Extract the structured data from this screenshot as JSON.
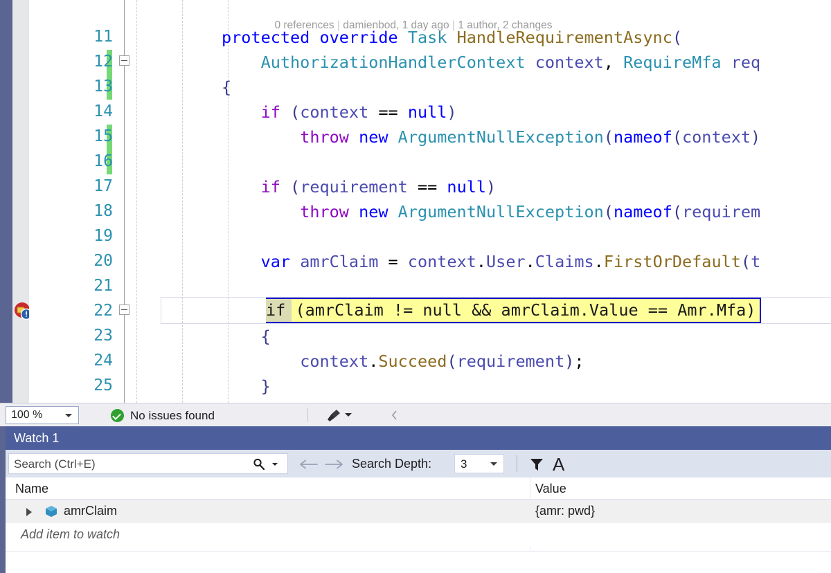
{
  "editor": {
    "codelens": {
      "references": "0 references",
      "author_change": "damienbod, 1 day ago",
      "changes": "1 author, 2 changes",
      "separator": "|"
    },
    "zoom_level": "100 %",
    "lines": [
      {
        "number": "11",
        "indent": 0,
        "tokens": [
          {
            "t": "protected ",
            "c": "kw"
          },
          {
            "t": "override ",
            "c": "kw"
          },
          {
            "t": "Task ",
            "c": "typ"
          },
          {
            "t": "HandleRequirementAsync",
            "c": "mth"
          },
          {
            "t": "(",
            "c": "brc"
          }
        ]
      },
      {
        "number": "12",
        "indent": 0,
        "tokens": [
          {
            "t": "    ",
            "c": "pun"
          },
          {
            "t": "AuthorizationHandlerContext ",
            "c": "typ"
          },
          {
            "t": "context",
            "c": "par"
          },
          {
            "t": ", ",
            "c": "pun"
          },
          {
            "t": "RequireMfa ",
            "c": "typ"
          },
          {
            "t": "req",
            "c": "par"
          }
        ]
      },
      {
        "number": "13",
        "indent": 0,
        "tokens": [
          {
            "t": "{",
            "c": "brc"
          }
        ]
      },
      {
        "number": "14",
        "indent": 0,
        "tokens": [
          {
            "t": "    ",
            "c": "pun"
          },
          {
            "t": "if",
            "c": "ctl"
          },
          {
            "t": " (",
            "c": "brc"
          },
          {
            "t": "context",
            "c": "par"
          },
          {
            "t": " == ",
            "c": "pun"
          },
          {
            "t": "null",
            "c": "kw"
          },
          {
            "t": ")",
            "c": "brc"
          }
        ]
      },
      {
        "number": "15",
        "indent": 0,
        "tokens": [
          {
            "t": "        ",
            "c": "pun"
          },
          {
            "t": "throw ",
            "c": "ctl"
          },
          {
            "t": "new ",
            "c": "kw"
          },
          {
            "t": "ArgumentNullException",
            "c": "typ"
          },
          {
            "t": "(",
            "c": "brc"
          },
          {
            "t": "nameof",
            "c": "kw"
          },
          {
            "t": "(",
            "c": "brc"
          },
          {
            "t": "context",
            "c": "par"
          },
          {
            "t": ")",
            "c": "brc"
          }
        ]
      },
      {
        "number": "16",
        "indent": 0,
        "tokens": []
      },
      {
        "number": "17",
        "indent": 0,
        "tokens": [
          {
            "t": "    ",
            "c": "pun"
          },
          {
            "t": "if",
            "c": "ctl"
          },
          {
            "t": " (",
            "c": "brc"
          },
          {
            "t": "requirement",
            "c": "par"
          },
          {
            "t": " == ",
            "c": "pun"
          },
          {
            "t": "null",
            "c": "kw"
          },
          {
            "t": ")",
            "c": "brc"
          }
        ]
      },
      {
        "number": "18",
        "indent": 0,
        "tokens": [
          {
            "t": "        ",
            "c": "pun"
          },
          {
            "t": "throw ",
            "c": "ctl"
          },
          {
            "t": "new ",
            "c": "kw"
          },
          {
            "t": "ArgumentNullException",
            "c": "typ"
          },
          {
            "t": "(",
            "c": "brc"
          },
          {
            "t": "nameof",
            "c": "kw"
          },
          {
            "t": "(",
            "c": "brc"
          },
          {
            "t": "requirem",
            "c": "par"
          }
        ]
      },
      {
        "number": "19",
        "indent": 0,
        "tokens": []
      },
      {
        "number": "20",
        "indent": 0,
        "tokens": [
          {
            "t": "    ",
            "c": "pun"
          },
          {
            "t": "var ",
            "c": "kw"
          },
          {
            "t": "amrClaim",
            "c": "par"
          },
          {
            "t": " = ",
            "c": "pun"
          },
          {
            "t": "context",
            "c": "par"
          },
          {
            "t": ".",
            "c": "pun"
          },
          {
            "t": "User",
            "c": "par"
          },
          {
            "t": ".",
            "c": "pun"
          },
          {
            "t": "Claims",
            "c": "par"
          },
          {
            "t": ".",
            "c": "pun"
          },
          {
            "t": "FirstOrDefault",
            "c": "mth"
          },
          {
            "t": "(",
            "c": "brc"
          },
          {
            "t": "t",
            "c": "par"
          }
        ]
      },
      {
        "number": "21",
        "indent": 0,
        "tokens": []
      },
      {
        "number": "22",
        "indent": 0,
        "highlighted": true,
        "text": "if (amrClaim != null && amrClaim.Value == Amr.Mfa)",
        "tokens": []
      },
      {
        "number": "23",
        "indent": 0,
        "tokens": [
          {
            "t": "    ",
            "c": "pun"
          },
          {
            "t": "{",
            "c": "brc"
          }
        ]
      },
      {
        "number": "24",
        "indent": 0,
        "tokens": [
          {
            "t": "        ",
            "c": "pun"
          },
          {
            "t": "context",
            "c": "par"
          },
          {
            "t": ".",
            "c": "pun"
          },
          {
            "t": "Succeed",
            "c": "mth"
          },
          {
            "t": "(",
            "c": "brc"
          },
          {
            "t": "requirement",
            "c": "par"
          },
          {
            "t": ")",
            "c": "brc"
          },
          {
            "t": ";",
            "c": "pun"
          }
        ]
      },
      {
        "number": "25",
        "indent": 0,
        "tokens": [
          {
            "t": "    ",
            "c": "pun"
          },
          {
            "t": "}",
            "c": "brc"
          }
        ]
      }
    ]
  },
  "statusbar": {
    "zoom_value": "100 %",
    "issues_text": "No issues found",
    "ok_icon": "check-circle-icon",
    "brush_icon": "brush-icon",
    "chevron_icon": "chevron-left-icon"
  },
  "watch": {
    "title": "Watch 1",
    "search_placeholder": "Search (Ctrl+E)",
    "search_icon": "magnifier-icon",
    "back_icon": "arrow-left-icon",
    "forward_icon": "arrow-right-icon",
    "depth_label": "Search Depth:",
    "depth_value": "3",
    "filter_icon": "funnel-icon",
    "font_icon": "letter-a-icon",
    "columns": [
      "Name",
      "Value"
    ],
    "rows": [
      {
        "name": "amrClaim",
        "value": "{amr: pwd}",
        "icon": "object-cube-icon",
        "expander": "chevron-right-icon"
      }
    ],
    "add_item_text": "Add item to watch"
  },
  "colors": {
    "keyword": "#0000ff",
    "control": "#8f08c4",
    "type": "#2b91af",
    "method": "#8b6c1f",
    "param": "#4a4ab0",
    "highlight_bg": "#ffff99",
    "highlight_border": "#1414c8",
    "word_highlight": "#dcdcb4",
    "changebar": "#75d975",
    "panel_title": "#4c5f9c",
    "accent_left": "#5b6591"
  }
}
